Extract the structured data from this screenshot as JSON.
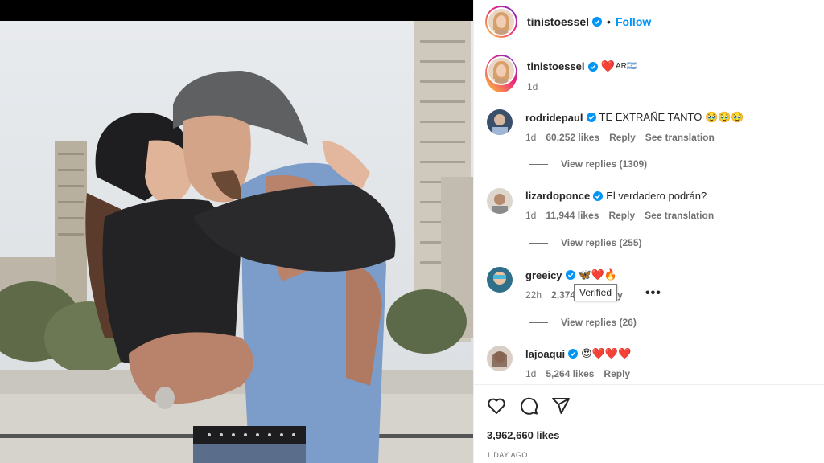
{
  "post": {
    "author": "tinistoessel",
    "follow_label": "Follow",
    "separator": "•",
    "caption_text": "AR🇦🇷",
    "caption_heart": "❤️",
    "caption_time": "1d"
  },
  "comments": [
    {
      "username": "rodridepaul",
      "text": "TE EXTRAÑE TANTO 🥹🥹🥹",
      "time": "1d",
      "likes": "60,252 likes",
      "reply": "Reply",
      "translate": "See translation",
      "view_replies": "View replies (1309)"
    },
    {
      "username": "lizardoponce",
      "text": "El verdadero podrán?",
      "time": "1d",
      "likes": "11,944 likes",
      "reply": "Reply",
      "translate": "See translation",
      "view_replies": "View replies (255)"
    },
    {
      "username": "greeicy",
      "text": "🦋❤️🔥",
      "time": "22h",
      "likes": "2,374",
      "reply_partial": "y",
      "view_replies": "View replies (26)",
      "tooltip": "Verified"
    },
    {
      "username": "lajoaqui",
      "text": "😍❤️❤️❤️",
      "time": "1d",
      "likes": "5,264 likes",
      "reply": "Reply"
    }
  ],
  "footer": {
    "likes": "3,962,660 likes",
    "date": "1 DAY AGO"
  },
  "colors": {
    "accent": "#0095f6",
    "verified": "#0095f6",
    "heart": "#ed2d3a",
    "muted": "#737373"
  }
}
